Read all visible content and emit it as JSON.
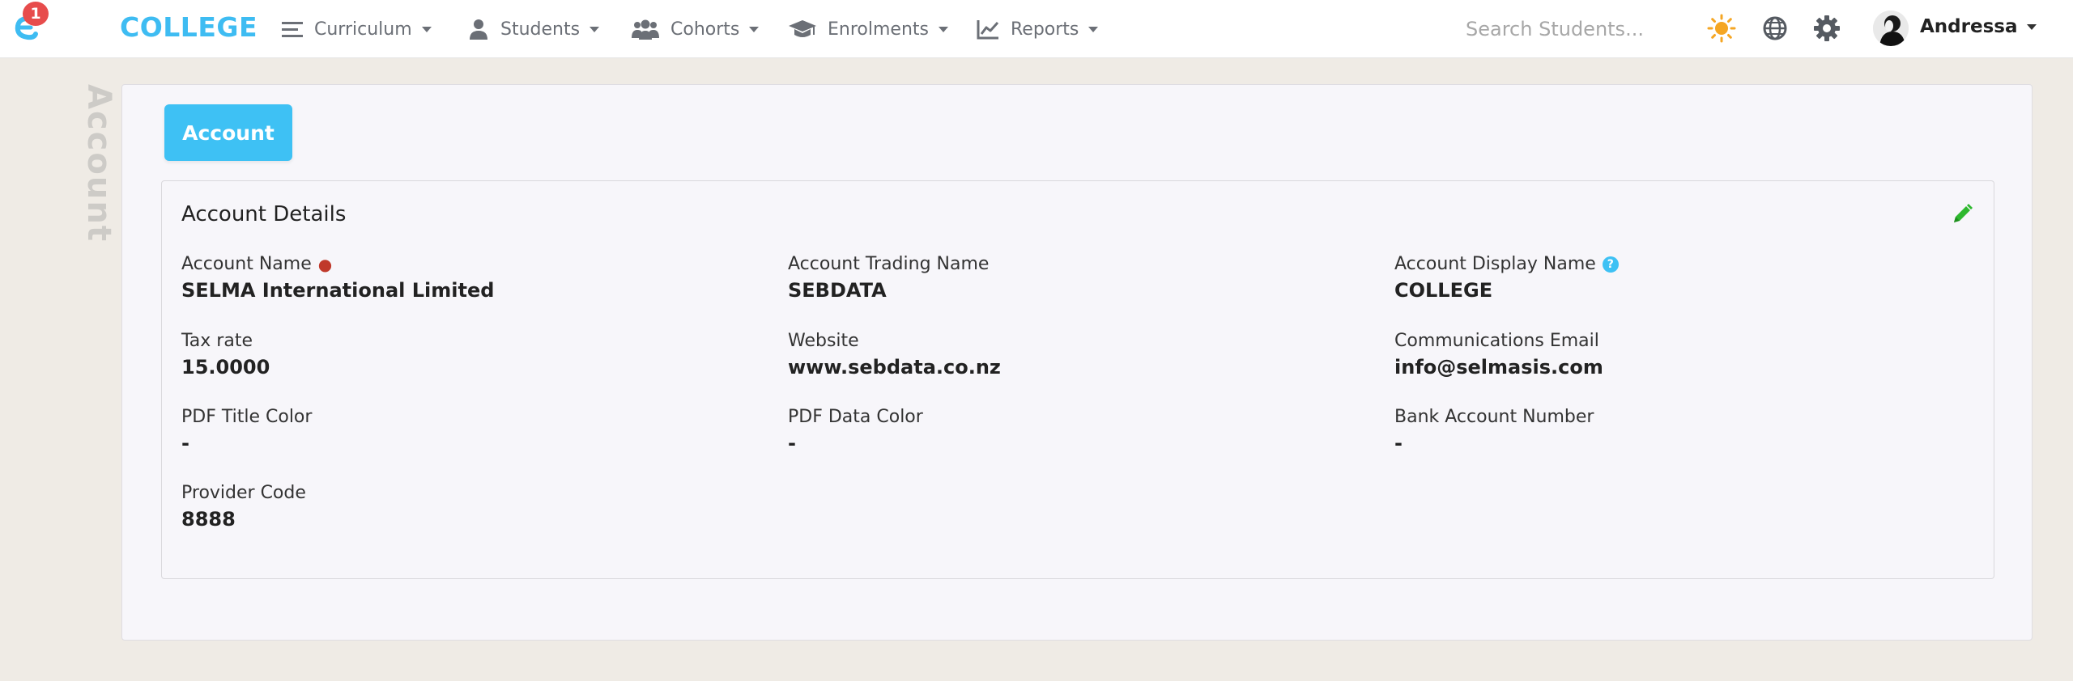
{
  "navbar": {
    "notification_count": "1",
    "brand": "COLLEGE",
    "menu": [
      {
        "label": "Curriculum"
      },
      {
        "label": "Students"
      },
      {
        "label": "Cohorts"
      },
      {
        "label": "Enrolments"
      },
      {
        "label": "Reports"
      }
    ],
    "search_placeholder": "Search Students...",
    "user_name": "Andressa",
    "icons": [
      "logo-icon",
      "list-icon",
      "user-icon",
      "users-icon",
      "graduation-cap-icon",
      "line-chart-icon",
      "sun-icon",
      "globe-icon",
      "gear-icon"
    ]
  },
  "page": {
    "side_label": "Account",
    "tab_label": "Account"
  },
  "details": {
    "title": "Account Details",
    "fields": [
      {
        "label": "Account Name",
        "value": "SELMA International Limited",
        "required": true
      },
      {
        "label": "Account Trading Name",
        "value": "SEBDATA"
      },
      {
        "label": "Account Display Name",
        "value": "COLLEGE",
        "help": true
      },
      {
        "label": "Tax rate",
        "value": "15.0000"
      },
      {
        "label": "Website",
        "value": "www.sebdata.co.nz"
      },
      {
        "label": "Communications Email",
        "value": "info@selmasis.com"
      },
      {
        "label": "PDF Title Color",
        "value": "-"
      },
      {
        "label": "PDF Data Color",
        "value": "-"
      },
      {
        "label": "Bank Account Number",
        "value": "-"
      },
      {
        "label": "Provider Code",
        "value": "8888"
      }
    ]
  },
  "colors": {
    "accent": "#3ec1f4",
    "badge": "#e74c4c",
    "edit_icon": "#2eb82e",
    "sun_icon": "#f5a623"
  }
}
